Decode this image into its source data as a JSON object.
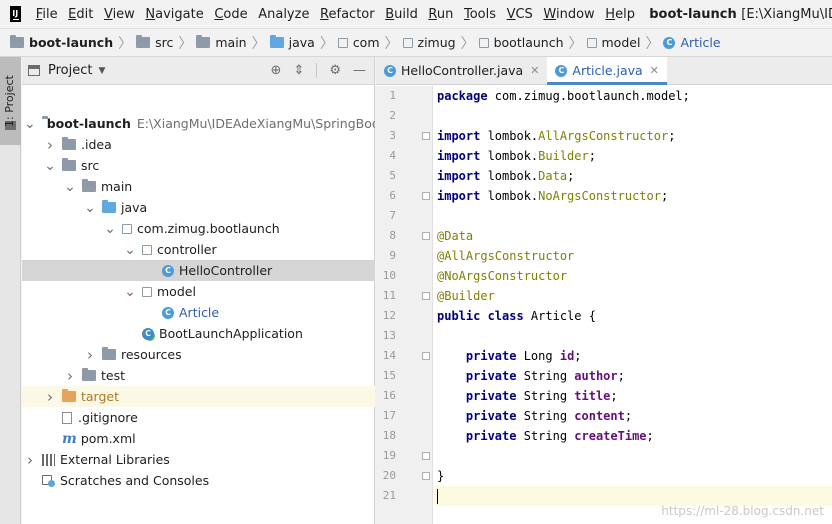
{
  "menubar": {
    "items": [
      {
        "label": "File",
        "mnemonic": "F",
        "rest": "ile"
      },
      {
        "label": "Edit",
        "mnemonic": "E",
        "rest": "dit"
      },
      {
        "label": "View",
        "mnemonic": "V",
        "rest": "iew"
      },
      {
        "label": "Navigate",
        "mnemonic": "N",
        "rest": "avigate"
      },
      {
        "label": "Code",
        "mnemonic": "C",
        "rest": "ode"
      },
      {
        "label": "Analyze",
        "mnemonic": "",
        "rest": "Analyze"
      },
      {
        "label": "Refactor",
        "mnemonic": "R",
        "rest": "efactor"
      },
      {
        "label": "Build",
        "mnemonic": "B",
        "rest": "uild"
      },
      {
        "label": "Run",
        "mnemonic": "R",
        "rest": "un"
      },
      {
        "label": "Tools",
        "mnemonic": "T",
        "rest": "ools"
      },
      {
        "label": "VCS",
        "mnemonic": "V",
        "rest": "CS"
      },
      {
        "label": "Window",
        "mnemonic": "W",
        "rest": "indow"
      },
      {
        "label": "Help",
        "mnemonic": "H",
        "rest": "elp"
      }
    ],
    "window_title": "boot-launch",
    "window_path": "[E:\\XiangMu\\IDEAdeXiangMu"
  },
  "breadcrumb": [
    {
      "label": "boot-launch",
      "icon": "folder-icon"
    },
    {
      "label": "src",
      "icon": "folder-icon"
    },
    {
      "label": "main",
      "icon": "folder-icon"
    },
    {
      "label": "java",
      "icon": "source-folder-icon"
    },
    {
      "label": "com",
      "icon": "package-icon"
    },
    {
      "label": "zimug",
      "icon": "package-icon"
    },
    {
      "label": "bootlaunch",
      "icon": "package-icon"
    },
    {
      "label": "model",
      "icon": "package-icon"
    },
    {
      "label": "Article",
      "icon": "class-icon"
    }
  ],
  "toolstrip": {
    "project_tab": "1: Project"
  },
  "project_panel": {
    "title": "Project",
    "tree": [
      {
        "label": "boot-launch",
        "path": "E:\\XiangMu\\IDEAdeXiangMu\\SpringBoot",
        "depth": 0,
        "arrow": "down",
        "icon": "folder",
        "style": "bold"
      },
      {
        "label": ".idea",
        "depth": 1,
        "arrow": "right",
        "icon": "folder"
      },
      {
        "label": "src",
        "depth": 1,
        "arrow": "down",
        "icon": "folder"
      },
      {
        "label": "main",
        "depth": 2,
        "arrow": "down",
        "icon": "folder"
      },
      {
        "label": "java",
        "depth": 3,
        "arrow": "down",
        "icon": "source-folder"
      },
      {
        "label": "com.zimug.bootlaunch",
        "depth": 4,
        "arrow": "down",
        "icon": "package"
      },
      {
        "label": "controller",
        "depth": 5,
        "arrow": "down",
        "icon": "package"
      },
      {
        "label": "HelloController",
        "depth": 6,
        "arrow": "none",
        "icon": "class",
        "selected": true
      },
      {
        "label": "model",
        "depth": 5,
        "arrow": "down",
        "icon": "package"
      },
      {
        "label": "Article",
        "depth": 6,
        "arrow": "none",
        "icon": "class",
        "style": "link"
      },
      {
        "label": "BootLaunchApplication",
        "depth": 5,
        "arrow": "none",
        "icon": "app-class"
      },
      {
        "label": "resources",
        "depth": 3,
        "arrow": "right",
        "icon": "resources-folder"
      },
      {
        "label": "test",
        "depth": 2,
        "arrow": "right",
        "icon": "folder"
      },
      {
        "label": "target",
        "depth": 1,
        "arrow": "right",
        "icon": "excluded-folder",
        "style": "orange",
        "excluded": true
      },
      {
        "label": ".gitignore",
        "depth": 1,
        "arrow": "none",
        "icon": "file"
      },
      {
        "label": "pom.xml",
        "depth": 1,
        "arrow": "none",
        "icon": "maven"
      },
      {
        "label": "External Libraries",
        "depth": 0,
        "arrow": "right",
        "icon": "library"
      },
      {
        "label": "Scratches and Consoles",
        "depth": 0,
        "arrow": "none",
        "icon": "scratch"
      }
    ]
  },
  "editor": {
    "tabs": [
      {
        "label": "HelloController.java",
        "active": false
      },
      {
        "label": "Article.java",
        "active": true
      }
    ],
    "lines": [
      {
        "n": "1"
      },
      {
        "n": "2"
      },
      {
        "n": "3"
      },
      {
        "n": "4"
      },
      {
        "n": "5"
      },
      {
        "n": "6"
      },
      {
        "n": "7"
      },
      {
        "n": "8"
      },
      {
        "n": "9"
      },
      {
        "n": "10"
      },
      {
        "n": "11"
      },
      {
        "n": "12"
      },
      {
        "n": "13"
      },
      {
        "n": "14"
      },
      {
        "n": "15"
      },
      {
        "n": "16"
      },
      {
        "n": "17"
      },
      {
        "n": "18"
      },
      {
        "n": "19"
      },
      {
        "n": "20"
      },
      {
        "n": "21"
      }
    ],
    "code": {
      "l1_kw": "package",
      "l1_rest": " com.zimug.bootlaunch.model;",
      "l3_kw": "import",
      "l3_pkg": " lombok.",
      "l3_cls": "AllArgsConstructor",
      "l3_end": ";",
      "l4_kw": "import",
      "l4_pkg": " lombok.",
      "l4_cls": "Builder",
      "l4_end": ";",
      "l5_kw": "import",
      "l5_pkg": " lombok.",
      "l5_cls": "Data",
      "l5_end": ";",
      "l6_kw": "import",
      "l6_pkg": " lombok.",
      "l6_cls": "NoArgsConstructor",
      "l6_end": ";",
      "l8": "@Data",
      "l9": "@AllArgsConstructor",
      "l10": "@NoArgsConstructor",
      "l11": "@Builder",
      "l12_kw": "public class",
      "l12_rest": " Article {",
      "l14_kw": "private",
      "l14_type": " Long ",
      "l14_fld": "id",
      "l14_end": ";",
      "l15_kw": "private",
      "l15_type": " String ",
      "l15_fld": "author",
      "l15_end": ";",
      "l16_kw": "private",
      "l16_type": " String ",
      "l16_fld": "title",
      "l16_end": ";",
      "l17_kw": "private",
      "l17_type": " String ",
      "l17_fld": "content",
      "l17_end": ";",
      "l18_kw": "private",
      "l18_type": " String ",
      "l18_fld": "createTime",
      "l18_end": ";",
      "l20": "}"
    }
  },
  "watermark": "https://ml-28.blog.csdn.net"
}
